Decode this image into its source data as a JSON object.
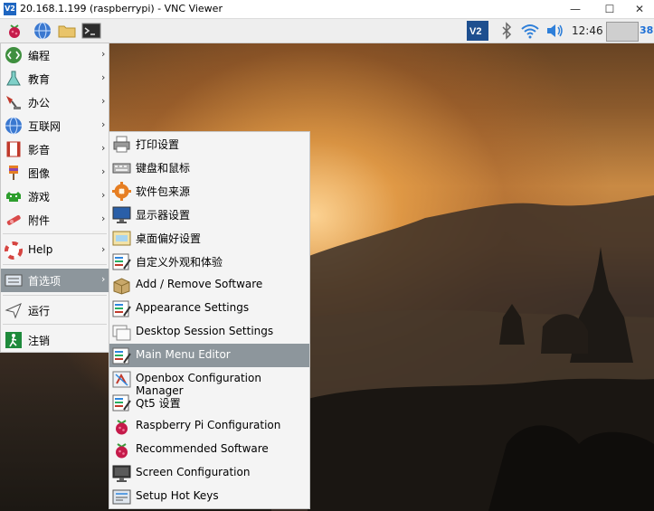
{
  "window": {
    "icon_text": "V2",
    "title": "20.168.1.199 (raspberrypi) - VNC Viewer",
    "minimize": "—",
    "maximize": "☐",
    "close": "✕"
  },
  "taskbar": {
    "clock": "12:46",
    "cpu_value": "38",
    "vnc_icon_text": "V2",
    "icons": [
      "raspberry-icon",
      "globe-icon",
      "folder-icon",
      "terminal-icon",
      "vnc-icon",
      "bluetooth-icon",
      "wifi-icon",
      "volume-icon"
    ]
  },
  "main_menu": {
    "items": [
      {
        "label": "编程",
        "icon": "programming-icon",
        "has_submenu": true
      },
      {
        "label": "教育",
        "icon": "education-icon",
        "has_submenu": true
      },
      {
        "label": "办公",
        "icon": "office-icon",
        "has_submenu": true
      },
      {
        "label": "互联网",
        "icon": "internet-icon",
        "has_submenu": true
      },
      {
        "label": "影音",
        "icon": "media-icon",
        "has_submenu": true
      },
      {
        "label": "图像",
        "icon": "graphics-icon",
        "has_submenu": true
      },
      {
        "label": "游戏",
        "icon": "games-icon",
        "has_submenu": true
      },
      {
        "label": "附件",
        "icon": "accessories-icon",
        "has_submenu": true
      },
      {
        "label": "Help",
        "icon": "help-icon",
        "has_submenu": true
      },
      {
        "label": "首选项",
        "icon": "preferences-icon",
        "has_submenu": true,
        "selected": true
      },
      {
        "label": "运行",
        "icon": "run-icon",
        "has_submenu": false
      },
      {
        "label": "注销",
        "icon": "logout-icon",
        "has_submenu": false
      }
    ],
    "arrow": "›"
  },
  "sub_menu": {
    "items": [
      {
        "label": "打印设置",
        "icon": "printer-icon"
      },
      {
        "label": "键盘和鼠标",
        "icon": "keyboard-mouse-icon"
      },
      {
        "label": "软件包来源",
        "icon": "software-sources-icon"
      },
      {
        "label": "显示器设置",
        "icon": "monitor-icon"
      },
      {
        "label": "桌面偏好设置",
        "icon": "desktop-preferences-icon"
      },
      {
        "label": "自定义外观和体验",
        "icon": "customize-look-icon"
      },
      {
        "label": "Add / Remove Software",
        "icon": "package-icon"
      },
      {
        "label": "Appearance Settings",
        "icon": "appearance-icon"
      },
      {
        "label": "Desktop Session Settings",
        "icon": "session-icon"
      },
      {
        "label": "Main Menu Editor",
        "icon": "menu-editor-icon",
        "selected": true
      },
      {
        "label": "Openbox Configuration Manager",
        "icon": "openbox-icon"
      },
      {
        "label": "Qt5 设置",
        "icon": "qt5-icon"
      },
      {
        "label": "Raspberry Pi Configuration",
        "icon": "raspberry-config-icon"
      },
      {
        "label": "Recommended Software",
        "icon": "recommended-icon"
      },
      {
        "label": "Screen Configuration",
        "icon": "screen-config-icon"
      },
      {
        "label": "Setup Hot Keys",
        "icon": "hotkeys-icon"
      }
    ]
  },
  "colors": {
    "menu_bg": "#f4f4f4",
    "selection": "#8d969c",
    "accent": "#1d6fd6"
  }
}
